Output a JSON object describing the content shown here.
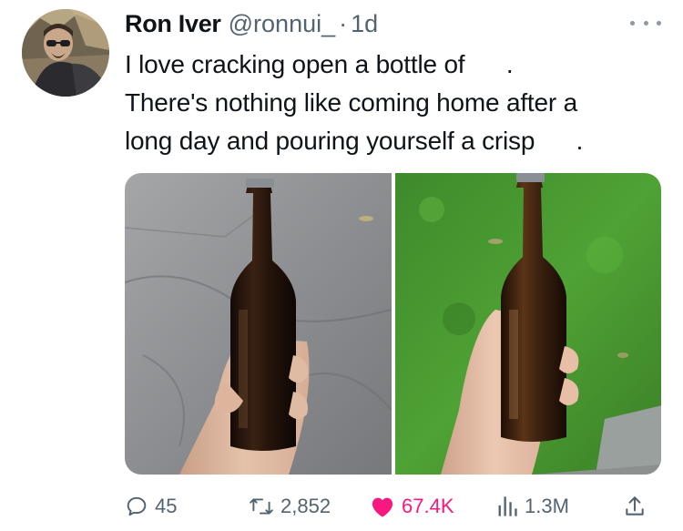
{
  "tweet": {
    "display_name": "Ron Iver",
    "handle": "@ronnui_",
    "separator": "·",
    "time": "1d",
    "text_lines": [
      "I love cracking open a bottle of      .",
      "There's nothing like coming home after a",
      "long day and pouring yourself a crisp      ."
    ]
  },
  "icons": {
    "more": "more-horizontal-icon",
    "reply": "reply-bubble-icon",
    "retweet": "retweet-icon",
    "like": "heart-filled-icon",
    "views": "views-bar-chart-icon",
    "share": "share-upload-icon"
  },
  "actions": {
    "reply_count": "45",
    "retweet_count": "2,852",
    "like_count": "67.4K",
    "view_count": "1.3M"
  },
  "colors": {
    "text": "#0f1419",
    "secondary": "#536471",
    "like": "#f91880"
  }
}
